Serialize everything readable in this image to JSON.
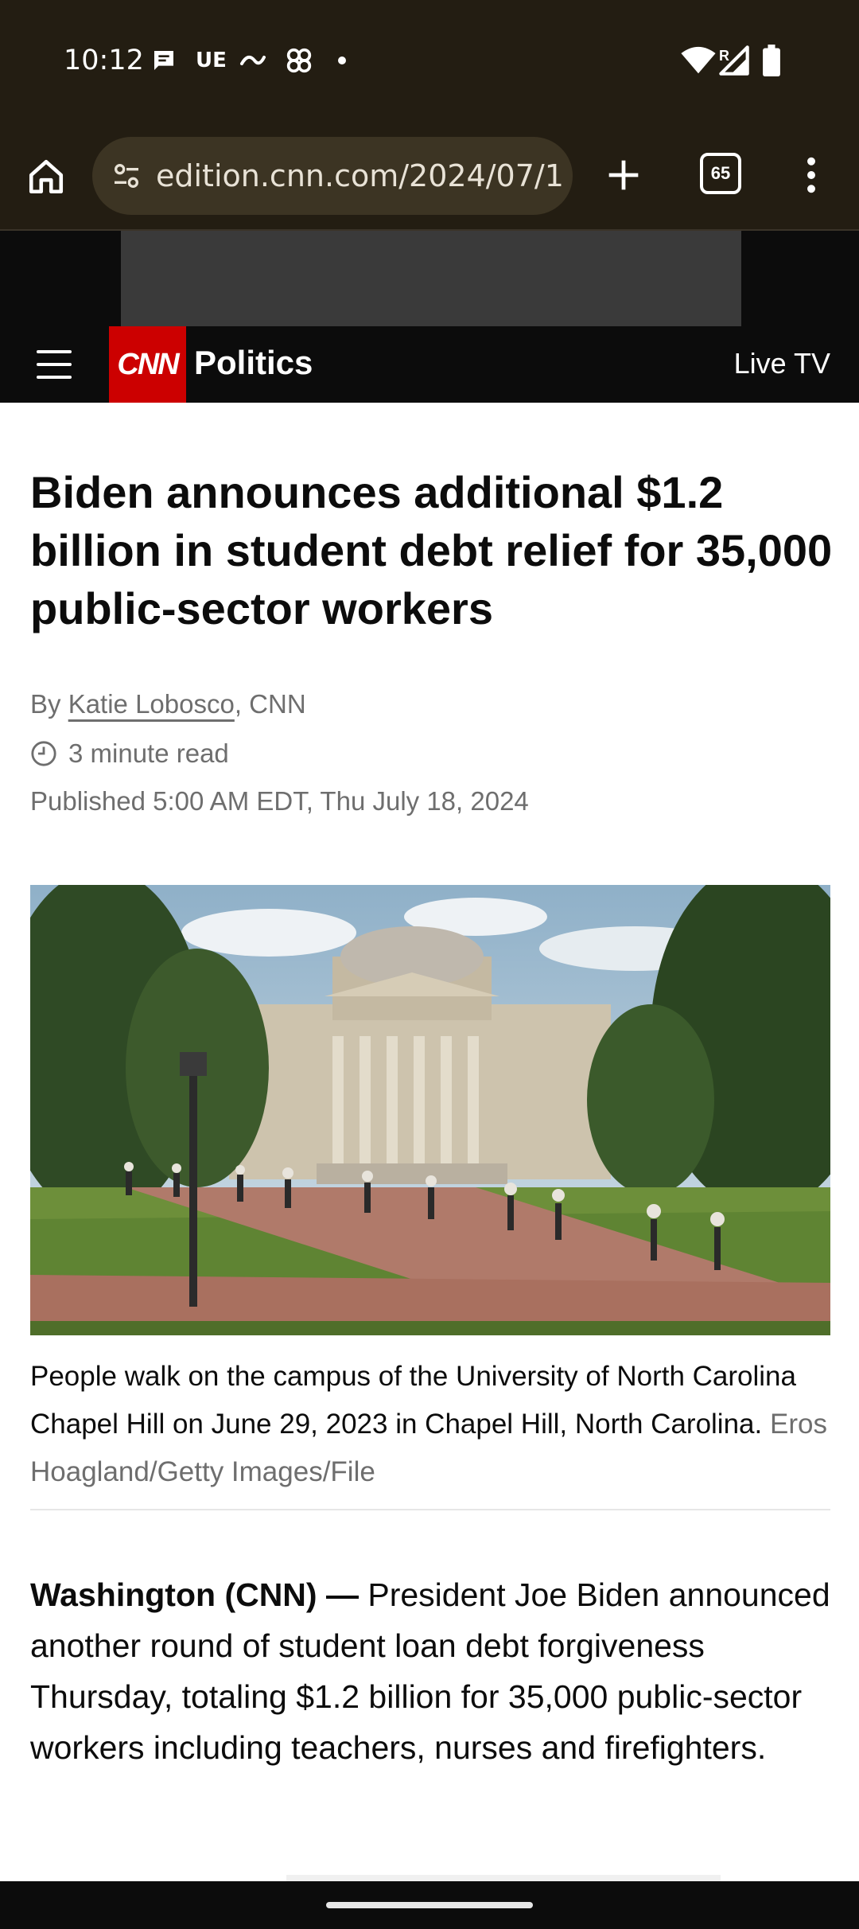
{
  "status_bar": {
    "time": "10:12",
    "carrier_label": "UE",
    "signal_label": "R"
  },
  "browser": {
    "url": "edition.cnn.com/2024/07/1",
    "tab_count": "65"
  },
  "site_nav": {
    "logo_text": "CNN",
    "section": "Politics",
    "live_tv": "Live TV"
  },
  "article": {
    "headline": "Biden announces additional $1.2 billion in student debt relief for 35,000 public-sector workers",
    "byline_prefix": "By ",
    "author": "Katie Lobosco",
    "byline_suffix": ", CNN",
    "read_time": "3 minute read",
    "published": "Published 5:00 AM EDT, Thu July 18, 2024",
    "image_caption": "People walk on the campus of the University of North Carolina Chapel Hill on June 29, 2023 in Chapel Hill, North Carolina.",
    "image_credit": "Eros Hoagland/Getty Images/File",
    "dateline": "Washington (CNN) —",
    "lead_paragraph": "President Joe Biden announced another round of student loan debt forgiveness Thursday, totaling $1.2 billion for 35,000 public-sector workers including teachers, nurses and firefighters."
  },
  "colors": {
    "brand_red": "#cc0000",
    "browser_chrome": "#231d12",
    "url_bar": "#3c3423",
    "nav_black": "#0c0c0c",
    "muted_text": "#6e6e6e"
  }
}
